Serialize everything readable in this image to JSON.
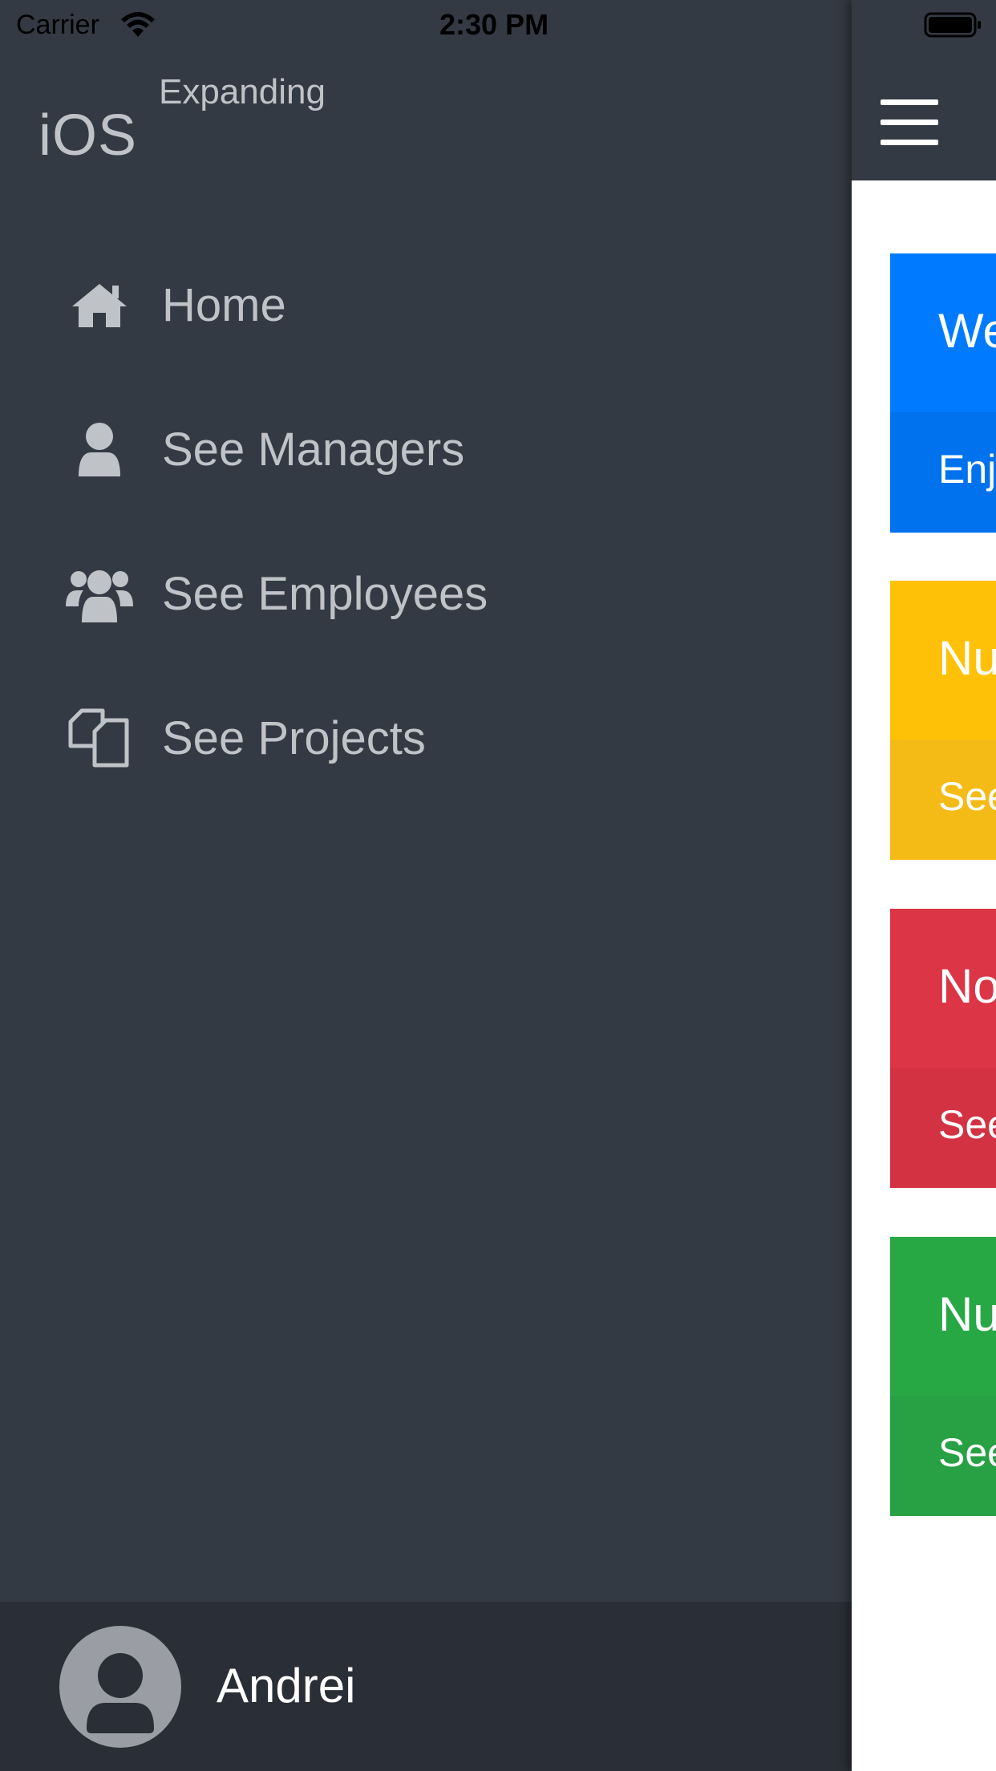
{
  "status_bar": {
    "carrier": "Carrier",
    "time": "2:30 PM"
  },
  "brand": {
    "main": "iOS",
    "sub": "Expanding"
  },
  "menu": {
    "items": [
      {
        "label": "Home",
        "icon": "home-icon"
      },
      {
        "label": "See Managers",
        "icon": "user-icon"
      },
      {
        "label": "See Employees",
        "icon": "users-icon"
      },
      {
        "label": "See Projects",
        "icon": "files-icon"
      }
    ]
  },
  "user": {
    "name": "Andrei"
  },
  "cards": [
    {
      "title": "We",
      "subtitle": "Enj",
      "color": "#007bff",
      "color_dark": "#0072ed"
    },
    {
      "title": "Nu",
      "subtitle": "See",
      "color": "#ffc107",
      "color_dark": "#f4ba16"
    },
    {
      "title": "No",
      "subtitle": "See",
      "color": "#dc3545",
      "color_dark": "#d33242"
    },
    {
      "title": "Nu",
      "subtitle": "See",
      "color": "#28a745",
      "color_dark": "#27a144"
    }
  ],
  "colors": {
    "drawer_bg": "#343a43",
    "user_bar_bg": "#2a2e36",
    "menu_text": "#bfc3c7"
  }
}
